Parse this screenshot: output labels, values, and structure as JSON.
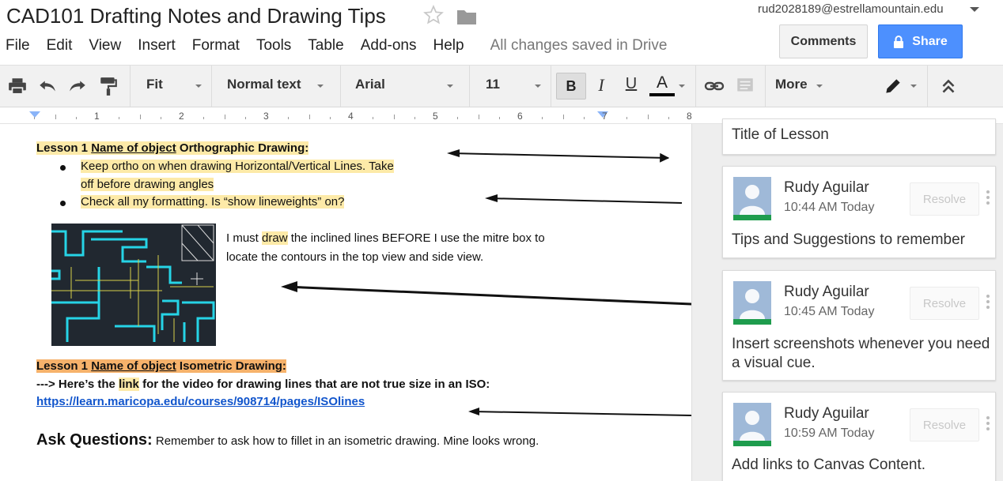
{
  "document": {
    "title": "CAD101 Drafting Notes and Drawing Tips",
    "save_status": "All changes saved in Drive"
  },
  "account": {
    "email": "rud2028189@estrellamountain.edu"
  },
  "header": {
    "comments_label": "Comments",
    "share_label": "Share"
  },
  "menu": [
    "File",
    "Edit",
    "View",
    "Insert",
    "Format",
    "Tools",
    "Table",
    "Add-ons",
    "Help"
  ],
  "toolbar": {
    "zoom": "Fit",
    "style": "Normal text",
    "font": "Arial",
    "size": "11",
    "bold": "B",
    "italic": "I",
    "underline": "U",
    "text_color": "A",
    "text_color_value": "#000000",
    "more": "More"
  },
  "ruler": {
    "labels": [
      "1",
      "2",
      "3",
      "4",
      "5",
      "6",
      "7",
      "8"
    ]
  },
  "body": {
    "lesson1_prefix": "Lesson 1 ",
    "lesson1_object": "Name of object",
    "lesson1_ortho": " Orthographic Drawing:",
    "bullet1_line1": "Keep ortho on when drawing Horizontal/Vertical Lines. Take",
    "bullet1_line2": "off before drawing angles ",
    "bullet2": "Check all my formatting. Is “show lineweights” on?",
    "note_pre": "I must ",
    "note_hl": "draw",
    "note_post": " the inclined lines BEFORE I use the mitre box to",
    "note_line2": "locate the contours in the top view and side view.",
    "lesson1_iso_prefix": "Lesson 1 ",
    "lesson1_iso_object": "Name of object",
    "lesson1_iso": " Isometric Drawing:",
    "video_pre": "---> Here’s the ",
    "video_link_word": "link",
    "video_post": " for the video for drawing lines that are not true size in an ISO:",
    "url": "https://learn.maricopa.edu/courses/908714/pages/ISOlines",
    "ask_heading": "Ask Questions:",
    "ask_text": " Remember to ask how to fillet in an isometric drawing. Mine looks wrong."
  },
  "comments": [
    {
      "text": "Title of Lesson"
    },
    {
      "author": "Rudy Aguilar",
      "time": "10:44 AM Today",
      "resolve": "Resolve",
      "text": "Tips and Suggestions to remember"
    },
    {
      "author": "Rudy Aguilar",
      "time": "10:45 AM Today",
      "resolve": "Resolve",
      "text_line1": "Insert screenshots whenever you need",
      "text_line2": "a visual cue."
    },
    {
      "author": "Rudy Aguilar",
      "time": "10:59 AM Today",
      "resolve": "Resolve",
      "text": "Add links to Canvas Content."
    }
  ],
  "colors": {
    "highlight_yellow": "#fdeaa8",
    "highlight_orange": "#f6b26b",
    "share_blue": "#4d90fe",
    "link_blue": "#1155cc",
    "avatar_green": "#1e9c4d"
  }
}
